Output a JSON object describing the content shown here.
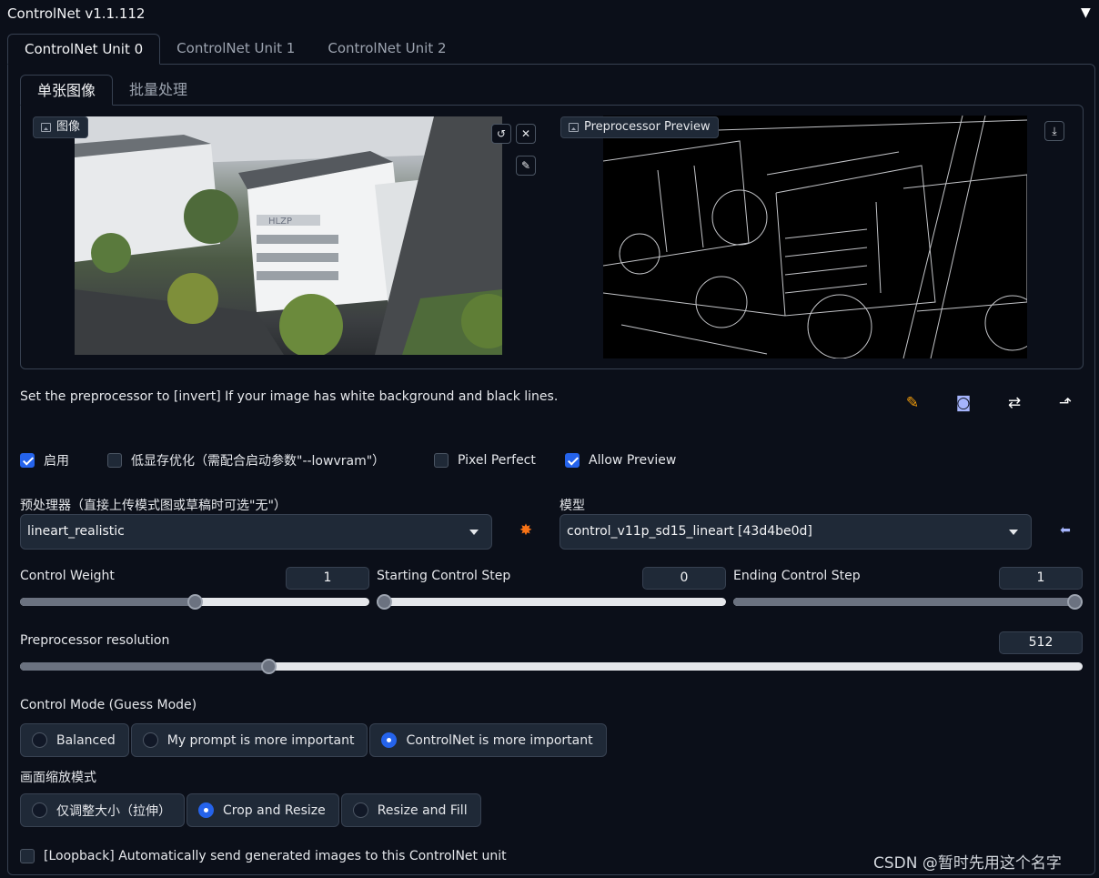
{
  "header": {
    "title": "ControlNet v1.1.112",
    "collapse_icon": "triangle-down-icon"
  },
  "unit_tabs": [
    "ControlNet Unit 0",
    "ControlNet Unit 1",
    "ControlNet Unit 2"
  ],
  "image_tabs": [
    "单张图像",
    "批量处理"
  ],
  "input_image": {
    "label": "图像",
    "photo_sign": "HLZP"
  },
  "preview_image": {
    "label": "Preprocessor Preview"
  },
  "hint": "Set the preprocessor to [invert] If your image has white background and black lines.",
  "checkboxes": {
    "enable": {
      "label": "启用",
      "checked": true
    },
    "low_vram": {
      "label": "低显存优化（需配合启动参数\"--lowvram\"）",
      "checked": false
    },
    "pixel_perfect": {
      "label": "Pixel Perfect",
      "checked": false
    },
    "allow_preview": {
      "label": "Allow Preview",
      "checked": true
    }
  },
  "preprocessor": {
    "label": "预处理器（直接上传模式图或草稿时可选\"无\"）",
    "value": "lineart_realistic"
  },
  "model": {
    "label": "模型",
    "value": "control_v11p_sd15_lineart [43d4be0d]"
  },
  "sliders": {
    "control_weight": {
      "label": "Control Weight",
      "value": "1",
      "fraction": 0.5
    },
    "starting_step": {
      "label": "Starting Control Step",
      "value": "0",
      "fraction": 0
    },
    "ending_step": {
      "label": "Ending Control Step",
      "value": "1",
      "fraction": 1
    },
    "preprocessor_resolution": {
      "label": "Preprocessor resolution",
      "value": "512",
      "fraction": 0.23
    }
  },
  "control_mode": {
    "label": "Control Mode (Guess Mode)",
    "options": [
      "Balanced",
      "My prompt is more important",
      "ControlNet is more important"
    ],
    "selected": "ControlNet is more important"
  },
  "resize_mode": {
    "label": "画面缩放模式",
    "options": [
      "仅调整大小（拉伸）",
      "Crop and Resize",
      "Resize and Fill"
    ],
    "selected": "Crop and Resize"
  },
  "loopback": {
    "label": "[Loopback] Automatically send generated images to this ControlNet unit",
    "checked": false
  },
  "watermark": "CSDN @暂时先用这个名字"
}
